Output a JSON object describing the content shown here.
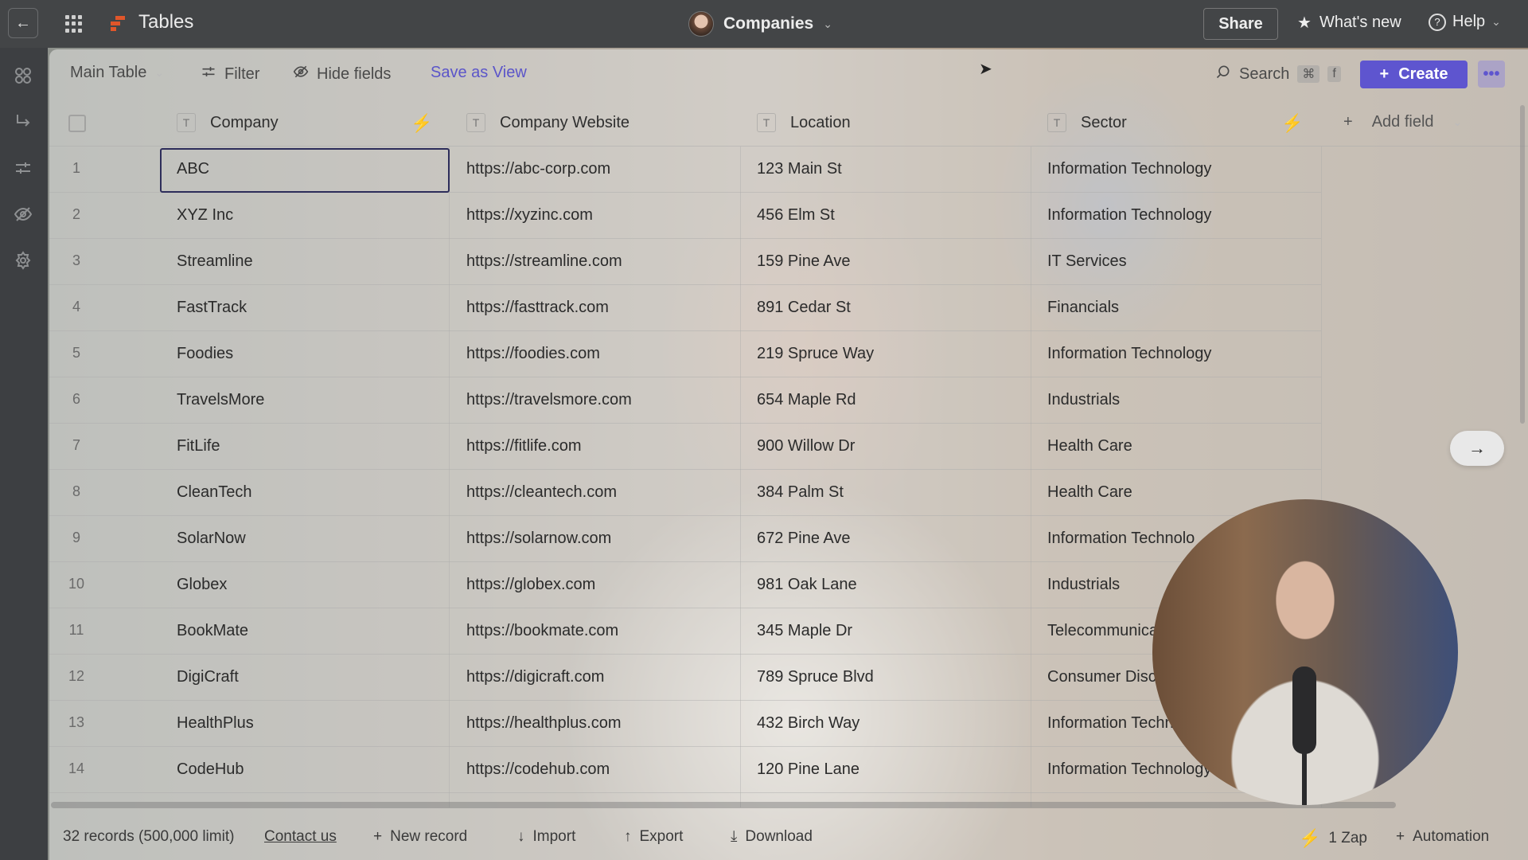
{
  "top_bar": {
    "back_icon": "arrow-left-icon",
    "apps_icon": "grid-dots-icon",
    "app_title": "Tables",
    "center_title": "Companies",
    "share_label": "Share",
    "whats_new_label": "What's new",
    "help_label": "Help"
  },
  "sidebar": {
    "items": [
      {
        "icon": "objects-icon"
      },
      {
        "icon": "redirect-arrow-icon"
      },
      {
        "icon": "filter-sliders-icon"
      },
      {
        "icon": "hidden-eye-icon"
      },
      {
        "icon": "gear-icon"
      }
    ]
  },
  "toolbar": {
    "view_label": "Main Table",
    "filter_label": "Filter",
    "hide_fields_label": "Hide fields",
    "save_view_label": "Save as View",
    "search_label": "Search",
    "search_kbd_1": "⌘",
    "search_kbd_2": "f",
    "create_label": "Create",
    "more_label": "•••"
  },
  "table": {
    "columns": [
      {
        "type_badge": "T",
        "label": "Company",
        "has_zap": true
      },
      {
        "type_badge": "T",
        "label": "Company Website",
        "has_zap": false
      },
      {
        "type_badge": "T",
        "label": "Location",
        "has_zap": false
      },
      {
        "type_badge": "T",
        "label": "Sector",
        "has_zap": true
      }
    ],
    "add_field_label": "Add field",
    "selected_cell": {
      "row": 1,
      "column": "Company"
    },
    "rows": [
      {
        "n": "1",
        "company": "ABC",
        "website": "https://abc-corp.com",
        "location": "123 Main St",
        "sector": "Information Technology"
      },
      {
        "n": "2",
        "company": "XYZ Inc",
        "website": "https://xyzinc.com",
        "location": "456 Elm St",
        "sector": "Information Technology"
      },
      {
        "n": "3",
        "company": "Streamline",
        "website": "https://streamline.com",
        "location": "159 Pine Ave",
        "sector": "IT Services"
      },
      {
        "n": "4",
        "company": "FastTrack",
        "website": "https://fasttrack.com",
        "location": "891 Cedar St",
        "sector": "Financials"
      },
      {
        "n": "5",
        "company": "Foodies",
        "website": "https://foodies.com",
        "location": "219 Spruce Way",
        "sector": "Information Technology"
      },
      {
        "n": "6",
        "company": "TravelsMore",
        "website": "https://travelsmore.com",
        "location": "654 Maple Rd",
        "sector": "Industrials"
      },
      {
        "n": "7",
        "company": "FitLife",
        "website": "https://fitlife.com",
        "location": "900 Willow Dr",
        "sector": "Health Care"
      },
      {
        "n": "8",
        "company": "CleanTech",
        "website": "https://cleantech.com",
        "location": "384 Palm St",
        "sector": "Health Care"
      },
      {
        "n": "9",
        "company": "SolarNow",
        "website": "https://solarnow.com",
        "location": "672 Pine Ave",
        "sector": "Information Technolo"
      },
      {
        "n": "10",
        "company": "Globex",
        "website": "https://globex.com",
        "location": "981 Oak Lane",
        "sector": "Industrials"
      },
      {
        "n": "11",
        "company": "BookMate",
        "website": "https://bookmate.com",
        "location": "345 Maple Dr",
        "sector": "Telecommunica"
      },
      {
        "n": "12",
        "company": "DigiCraft",
        "website": "https://digicraft.com",
        "location": "789 Spruce Blvd",
        "sector": "Consumer Disc"
      },
      {
        "n": "13",
        "company": "HealthPlus",
        "website": "https://healthplus.com",
        "location": "432 Birch Way",
        "sector": "Information Techn"
      },
      {
        "n": "14",
        "company": "CodeHub",
        "website": "https://codehub.com",
        "location": "120 Pine Lane",
        "sector": "Information Technology"
      }
    ]
  },
  "bottom_bar": {
    "records_label": "32 records (500,000 limit)",
    "contact_label": "Contact us",
    "new_record_label": "New record",
    "import_label": "Import",
    "export_label": "Export",
    "download_label": "Download",
    "zap_label": "1 Zap",
    "automation_label": "Automation"
  },
  "colors": {
    "accent": "#5e55cf",
    "zap": "#e5491c",
    "top_bar": "#434547"
  }
}
